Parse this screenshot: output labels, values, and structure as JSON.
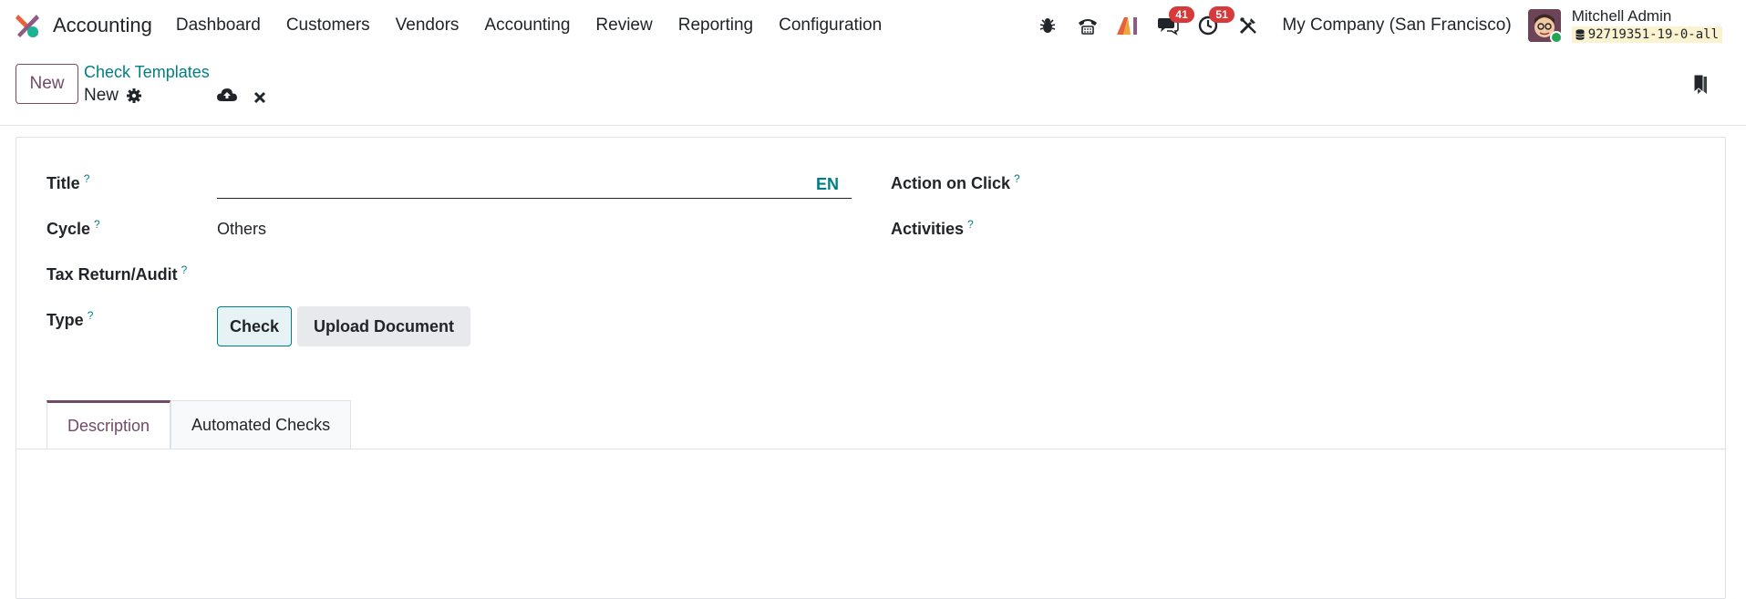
{
  "navbar": {
    "app_name": "Accounting",
    "menu": [
      "Dashboard",
      "Customers",
      "Vendors",
      "Accounting",
      "Review",
      "Reporting",
      "Configuration"
    ],
    "messages_count": "41",
    "activities_count": "51",
    "company": "My Company (San Francisco)",
    "user_name": "Mitchell Admin",
    "database": "92719351-19-0-all"
  },
  "control_panel": {
    "new_label": "New",
    "breadcrumb": "Check Templates",
    "record_name": "New"
  },
  "form": {
    "title_label": "Title",
    "title_value": "",
    "lang_label": "EN",
    "cycle_label": "Cycle",
    "cycle_value": "Others",
    "tax_label": "Tax Return/Audit",
    "type_label": "Type",
    "type_options": [
      "Check",
      "Upload Document"
    ],
    "type_selected": "Check",
    "action_label": "Action on Click",
    "activities_label": "Activities",
    "help_mark": "?"
  },
  "tabs": [
    "Description",
    "Automated Checks"
  ],
  "active_tab": "Description",
  "colors": {
    "brand": "#714b67",
    "link": "#017e84",
    "badge": "#d63a3a"
  }
}
